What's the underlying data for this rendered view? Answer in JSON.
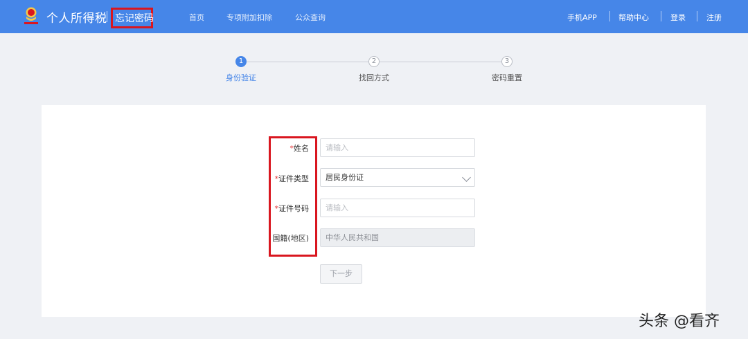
{
  "header": {
    "app_title": "个人所得税",
    "page_name": "忘记密码",
    "nav": [
      "首页",
      "专项附加扣除",
      "公众查询"
    ],
    "right_links": [
      "手机APP",
      "帮助中心",
      "登录",
      "注册"
    ]
  },
  "steps": [
    {
      "number": "1",
      "label": "身份验证",
      "active": true
    },
    {
      "number": "2",
      "label": "找回方式",
      "active": false
    },
    {
      "number": "3",
      "label": "密码重置",
      "active": false
    }
  ],
  "form": {
    "required_mark": "*",
    "name": {
      "label": "姓名",
      "placeholder": "请输入"
    },
    "id_type": {
      "label": "证件类型",
      "value": "居民身份证"
    },
    "id_number": {
      "label": "证件号码",
      "placeholder": "请输入"
    },
    "nationality": {
      "label": "国籍(地区)",
      "value": "中华人民共和国"
    },
    "next_button": "下一步"
  },
  "watermark": "头条 @看齐",
  "colors": {
    "primary": "#4686e8",
    "highlight_box": "#d9161f",
    "required": "#e4393c"
  },
  "icons": {
    "logo": "tax-emblem-icon",
    "select": "chevron-down-icon"
  }
}
